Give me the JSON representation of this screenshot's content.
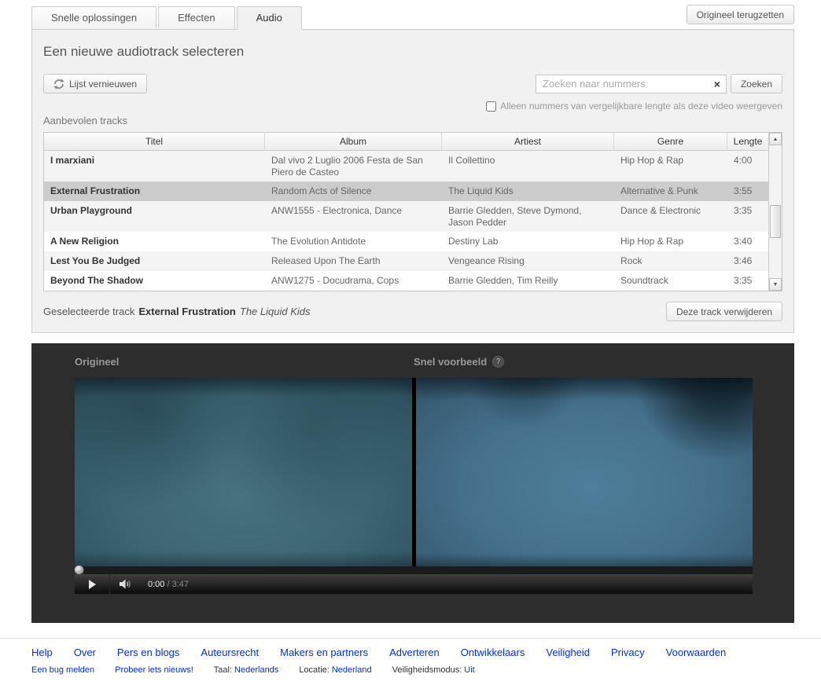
{
  "tabs": {
    "items": [
      {
        "label": "Snelle oplossingen",
        "active": false
      },
      {
        "label": "Effecten",
        "active": false
      },
      {
        "label": "Audio",
        "active": true
      }
    ],
    "restore_button": "Origineel terugzetten"
  },
  "audio_panel": {
    "title": "Een nieuwe audiotrack selecteren",
    "refresh_button": "Lijst vernieuwen",
    "search": {
      "placeholder": "Zoeken naar nummers",
      "button": "Zoeken"
    },
    "filter_label": "Alleen nummers van vergelijkbare lengte als deze video weergeven",
    "filter_checked": false,
    "recommended_label": "Aanbevolen tracks",
    "table": {
      "headers": [
        "Titel",
        "Album",
        "Artiest",
        "Genre",
        "Lengte"
      ],
      "rows": [
        {
          "title": "I marxiani",
          "album": "Dal vivo 2 Luglio 2006 Festa de San Piero de Casteo",
          "artist": "Il Collettino",
          "genre": "Hip Hop & Rap",
          "length": "4:00",
          "selected": false
        },
        {
          "title": "External Frustration",
          "album": "Random Acts of Silence",
          "artist": "The Liquid Kids",
          "genre": "Alternative & Punk",
          "length": "3:55",
          "selected": true
        },
        {
          "title": "Urban Playground",
          "album": "ANW1555 - Electronica, Dance",
          "artist": "Barrie Gledden, Steve Dymond, Jason Pedder",
          "genre": "Dance & Electronic",
          "length": "3:35",
          "selected": false
        },
        {
          "title": "A New Religion",
          "album": "The Evolution Antidote",
          "artist": "Destiny Lab",
          "genre": "Hip Hop & Rap",
          "length": "3:40",
          "selected": false
        },
        {
          "title": "Lest You Be Judged",
          "album": "Released Upon The Earth",
          "artist": "Vengeance Rising",
          "genre": "Rock",
          "length": "3:46",
          "selected": false
        },
        {
          "title": "Beyond The Shadow",
          "album": "ANW1275 - Docudrama, Cops",
          "artist": "Barrie Gledden, Tim Reilly",
          "genre": "Soundtrack",
          "length": "3:35",
          "selected": false
        }
      ]
    },
    "selected_track": {
      "label": "Geselecteerde track",
      "title": "External Frustration",
      "artist": "The Liquid Kids"
    },
    "remove_button": "Deze track verwijderen"
  },
  "preview": {
    "original_label": "Origineel",
    "quick_label": "Snel voorbeeld",
    "help_icon": "?",
    "player": {
      "time_current": "0:00",
      "time_separator": "/",
      "time_total": "3:47"
    }
  },
  "footer": {
    "links": [
      "Help",
      "Over",
      "Pers en blogs",
      "Auteursrecht",
      "Makers en partners",
      "Adverteren",
      "Ontwikkelaars",
      "Veiligheid",
      "Privacy",
      "Voorwaarden"
    ],
    "secondary": {
      "bug_link": "Een bug melden",
      "new_link": "Probeer iets nieuws!",
      "language_label": "Taal:",
      "language_value": "Nederlands",
      "location_label": "Locatie:",
      "location_value": "Nederland",
      "safety_label": "Veiligheidsmodus:",
      "safety_value": "Uit"
    }
  },
  "icons": {
    "clear": "×",
    "scroll_up": "▲",
    "scroll_down": "▼"
  },
  "colors": {
    "link_blue": "#0033cc",
    "panel_bg": "#f1f1f1",
    "selected_row": "#cccccc",
    "preview_bg": "#2d2d2d"
  }
}
